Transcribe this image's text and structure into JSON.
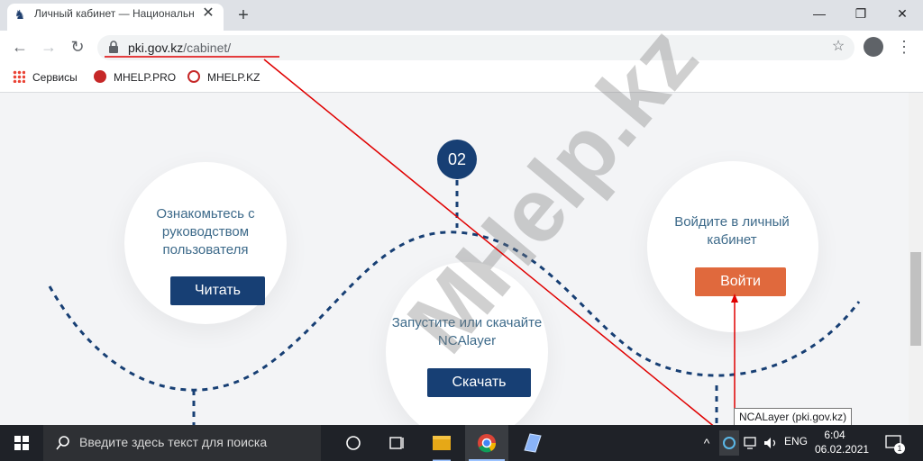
{
  "browser": {
    "tab_title": "Личный кабинет — Национальный",
    "url_host": "pki.gov.kz",
    "url_path": "/cabinet/",
    "bookmarks": [
      "Сервисы",
      "MHELP.PRO",
      "MHELP.KZ"
    ]
  },
  "page": {
    "step_number": "02",
    "circle_left_text": "Ознакомьтесь с руководством пользователя",
    "circle_left_button": "Читать",
    "circle_center_text": "Запустите или скачайте NCAlayer",
    "circle_center_button": "Скачать",
    "circle_right_text": "Войдите в личный кабинет",
    "circle_right_button": "Войти",
    "watermark": "MHelp.kz"
  },
  "tooltip": "NCALayer (pki.gov.kz)",
  "taskbar": {
    "search_placeholder": "Введите здесь текст для поиска",
    "language": "ENG",
    "time": "6:04",
    "date": "06.02.2021",
    "notification_count": "1"
  },
  "colors": {
    "navy": "#173f74",
    "orange": "#e0693d",
    "annotation_red": "#e00000"
  }
}
